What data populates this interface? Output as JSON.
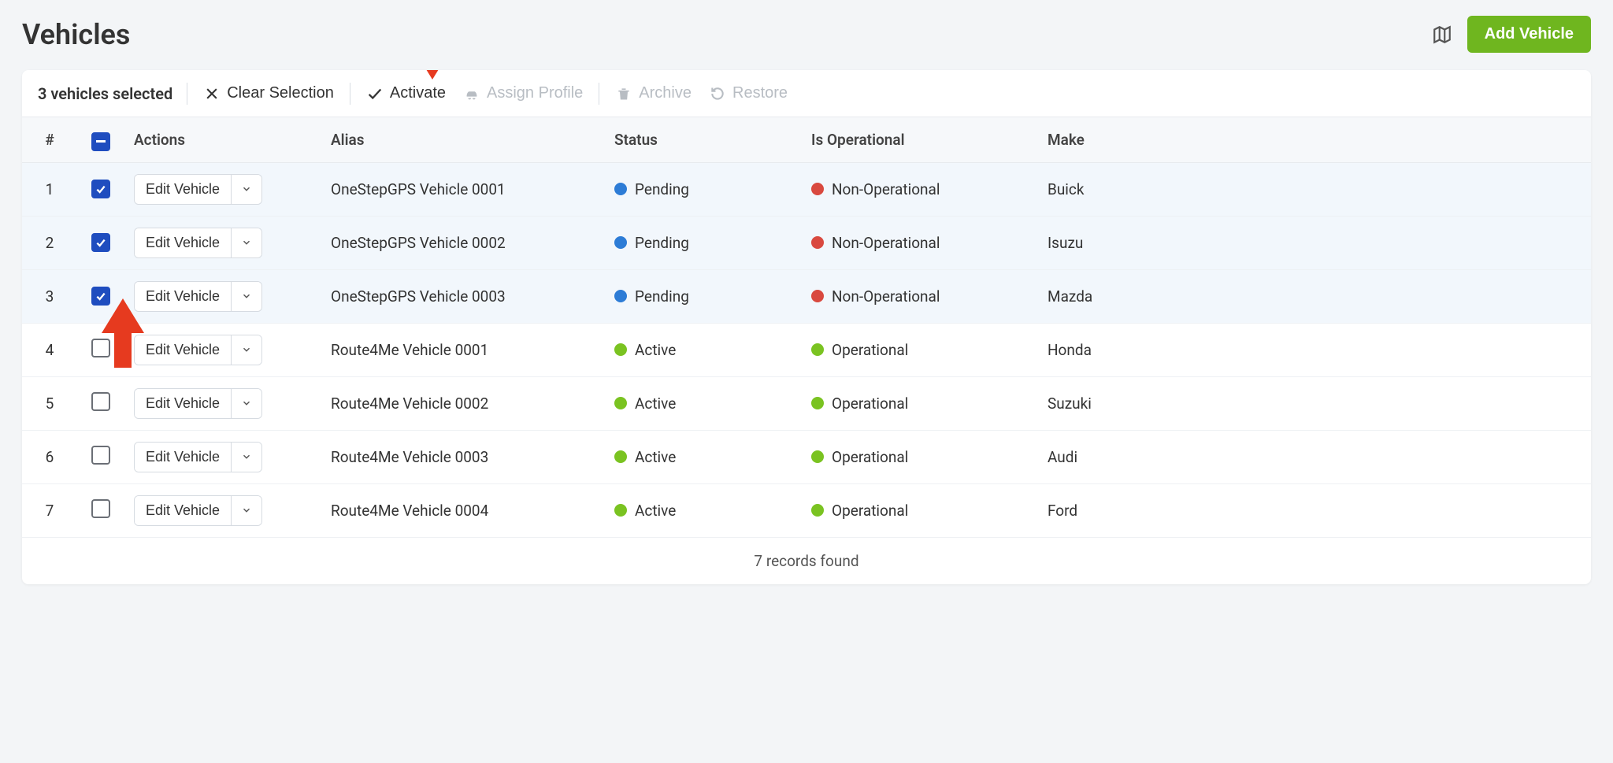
{
  "header": {
    "title": "Vehicles",
    "add_button": "Add Vehicle"
  },
  "toolbar": {
    "selected_text": "3 vehicles selected",
    "clear": "Clear Selection",
    "activate": "Activate",
    "assign_profile": "Assign Profile",
    "archive": "Archive",
    "restore": "Restore"
  },
  "columns": {
    "num": "#",
    "actions": "Actions",
    "alias": "Alias",
    "status": "Status",
    "operational": "Is Operational",
    "make": "Make"
  },
  "action_button_label": "Edit Vehicle",
  "rows": [
    {
      "num": "1",
      "checked": true,
      "alias": "OneStepGPS Vehicle 0001",
      "status": "Pending",
      "status_color": "blue",
      "operational": "Non-Operational",
      "op_color": "red",
      "make": "Buick"
    },
    {
      "num": "2",
      "checked": true,
      "alias": "OneStepGPS Vehicle 0002",
      "status": "Pending",
      "status_color": "blue",
      "operational": "Non-Operational",
      "op_color": "red",
      "make": "Isuzu"
    },
    {
      "num": "3",
      "checked": true,
      "alias": "OneStepGPS Vehicle 0003",
      "status": "Pending",
      "status_color": "blue",
      "operational": "Non-Operational",
      "op_color": "red",
      "make": "Mazda"
    },
    {
      "num": "4",
      "checked": false,
      "alias": "Route4Me Vehicle 0001",
      "status": "Active",
      "status_color": "green",
      "operational": "Operational",
      "op_color": "green",
      "make": "Honda"
    },
    {
      "num": "5",
      "checked": false,
      "alias": "Route4Me Vehicle 0002",
      "status": "Active",
      "status_color": "green",
      "operational": "Operational",
      "op_color": "green",
      "make": "Suzuki"
    },
    {
      "num": "6",
      "checked": false,
      "alias": "Route4Me Vehicle 0003",
      "status": "Active",
      "status_color": "green",
      "operational": "Operational",
      "op_color": "green",
      "make": "Audi"
    },
    {
      "num": "7",
      "checked": false,
      "alias": "Route4Me Vehicle 0004",
      "status": "Active",
      "status_color": "green",
      "operational": "Operational",
      "op_color": "green",
      "make": "Ford"
    }
  ],
  "footer": "7 records found",
  "colors": {
    "accent_green": "#6fb61f",
    "checkbox_blue": "#1f4dbf",
    "annotation_red": "#e63a1f"
  }
}
